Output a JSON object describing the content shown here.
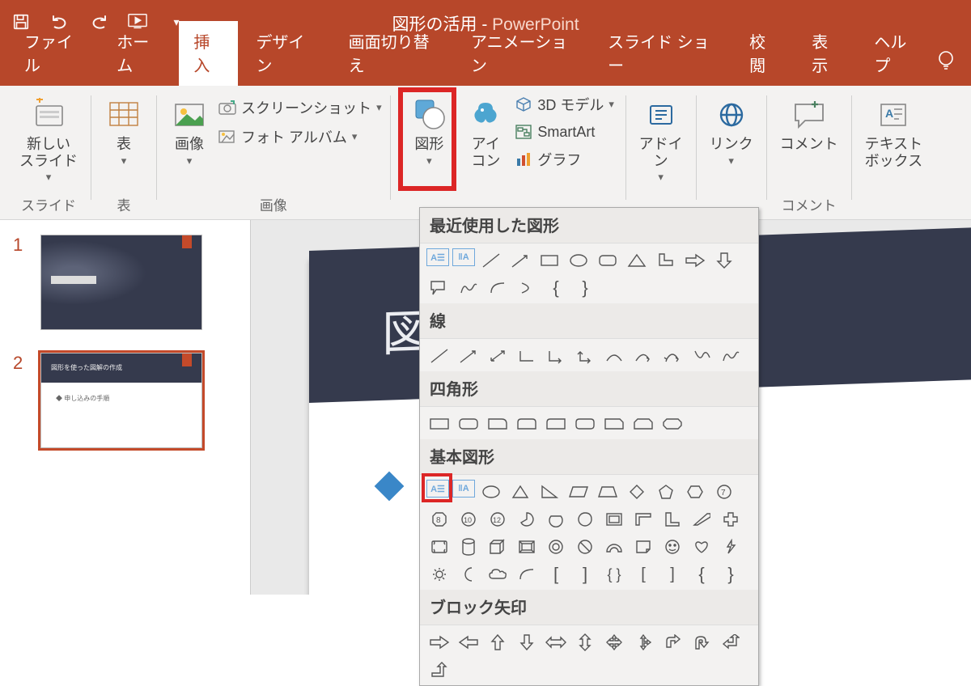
{
  "app": {
    "doc_title": "図形の活用",
    "app_name": "PowerPoint"
  },
  "tabs": {
    "file": "ファイル",
    "home": "ホーム",
    "insert": "挿入",
    "design": "デザイン",
    "transitions": "画面切り替え",
    "animations": "アニメーション",
    "slideshow": "スライド ショー",
    "review": "校閲",
    "view": "表示",
    "help": "ヘルプ"
  },
  "ribbon": {
    "new_slide": "新しい\nスライド",
    "table": "表",
    "group_slides": "スライド",
    "group_tables": "表",
    "images_btn": "画像",
    "screenshot": "スクリーンショット",
    "photo_album": "フォト アルバム",
    "group_images": "画像",
    "shapes_btn": "図形",
    "icon_btn": "アイ\nコン",
    "models_3d": "3D モデル",
    "smartart": "SmartArt",
    "chart": "グラフ",
    "addin": "アドイ\nン",
    "link": "リンク",
    "comment": "コメント",
    "group_comments": "コメント",
    "textbox": "テキスト\nボックス"
  },
  "gallery": {
    "recent": "最近使用した図形",
    "lines": "線",
    "rectangles": "四角形",
    "basic": "基本図形",
    "block_arrows": "ブロック矢印"
  },
  "slides": {
    "n1": "1",
    "n2": "2",
    "current_title": "図                          成"
  }
}
